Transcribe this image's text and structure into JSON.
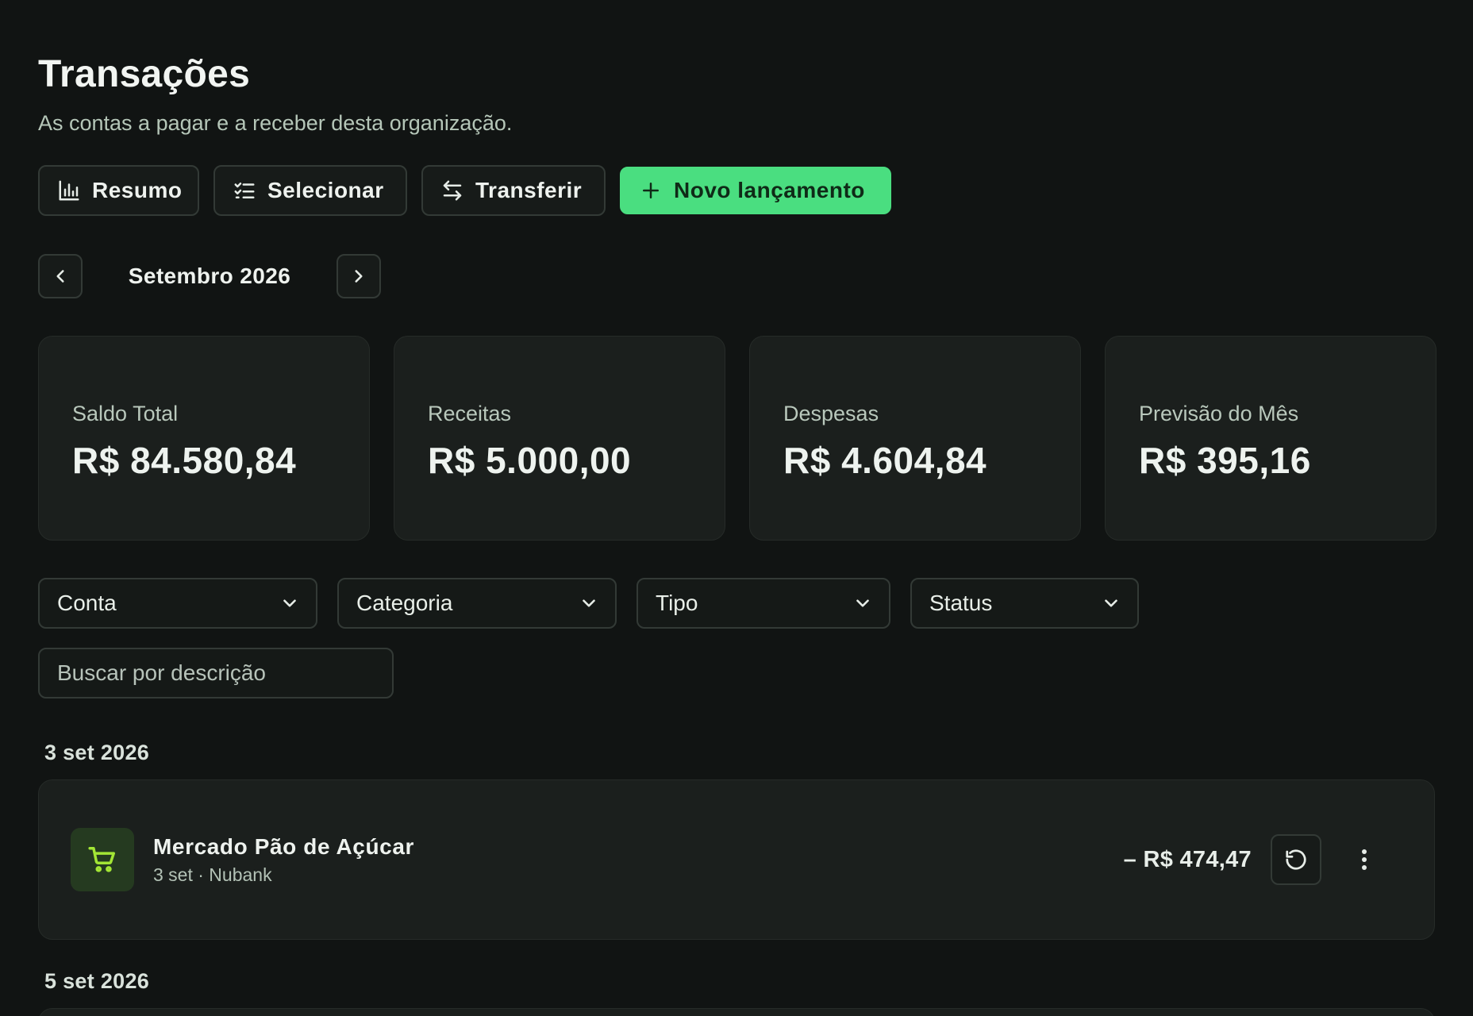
{
  "page": {
    "title": "Transações",
    "subtitle": "As contas a pagar e a receber desta organização."
  },
  "toolbar": {
    "summary_label": "Resumo",
    "select_label": "Selecionar",
    "transfer_label": "Transferir",
    "new_entry_label": "Novo lançamento"
  },
  "month_nav": {
    "label": "Setembro 2026"
  },
  "cards": [
    {
      "label": "Saldo Total",
      "value": "R$ 84.580,84"
    },
    {
      "label": "Receitas",
      "value": "R$ 5.000,00"
    },
    {
      "label": "Despesas",
      "value": "R$ 4.604,84"
    },
    {
      "label": "Previsão do Mês",
      "value": "R$ 395,16"
    }
  ],
  "filters": {
    "account": "Conta",
    "category": "Categoria",
    "type": "Tipo",
    "status": "Status"
  },
  "search": {
    "placeholder": "Buscar por descrição"
  },
  "groups": [
    {
      "date": "3 set 2026",
      "transactions": [
        {
          "icon": "shopping-cart-icon",
          "description": "Mercado Pão de Açúcar",
          "meta": "3 set · Nubank",
          "amount": "– R$ 474,47"
        }
      ]
    },
    {
      "date": "5 set 2026",
      "transactions": []
    }
  ],
  "colors": {
    "background": "#111413",
    "card": "#1b1f1d",
    "accent": "#4ade80",
    "category_icon": "#a3e635"
  }
}
